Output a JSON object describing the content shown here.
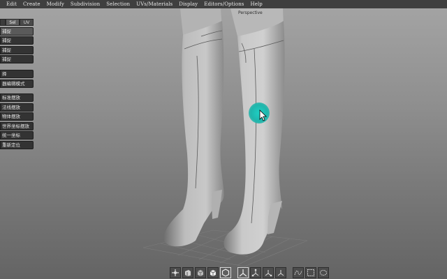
{
  "menubar": {
    "items": [
      "Edit",
      "Create",
      "Modify",
      "Subdivision",
      "Selection",
      "UVs/Materials",
      "Display",
      "Editors/Options",
      "Help"
    ]
  },
  "viewport": {
    "label": "Perspective"
  },
  "panel": {
    "tabs": [
      "Sel",
      "UV"
    ],
    "buttons": [
      "捕捉",
      "捕捉",
      "捕捉",
      "捕捉",
      "择",
      "器编辑模式",
      "标准摆放",
      "法线摆放",
      "物体摆放",
      "世界坐标摆放",
      "统一坐标",
      "重新定位"
    ]
  },
  "toolbar": {
    "icons": [
      "pivot-icon",
      "extrude-icon",
      "cube-shaded-icon",
      "cube-wire-icon",
      "hexagon-icon",
      "axis-tripod-icon",
      "axis-x-icon",
      "axis-y-icon",
      "axis-z-icon",
      "curve-icon",
      "grid-select-icon",
      "lasso-icon"
    ],
    "selected": [
      "hexagon-icon",
      "axis-tripod-icon"
    ]
  },
  "colors": {
    "menubar": "#3f3f3f",
    "cursor_highlight": "#1fc4b8",
    "panel_button": "#333333"
  }
}
